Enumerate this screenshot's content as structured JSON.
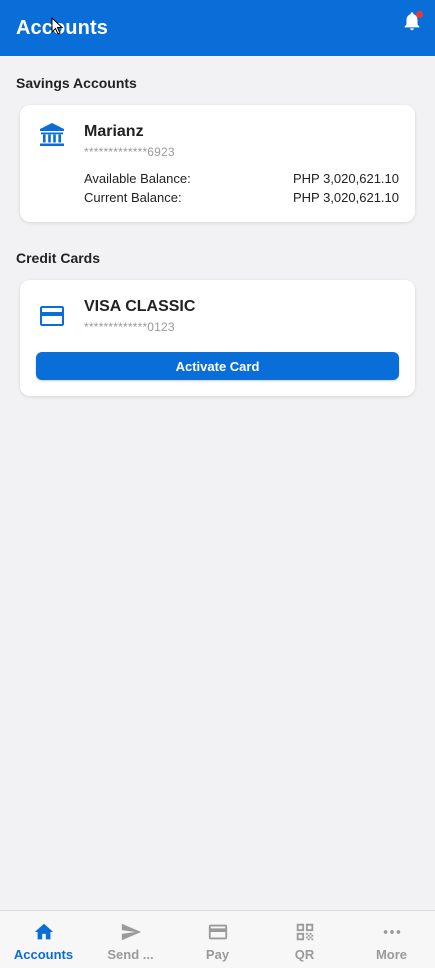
{
  "header": {
    "title": "Accounts",
    "notification_icon": "bell-icon",
    "notification_dot_color": "#e53935"
  },
  "savings": {
    "section_title": "Savings Accounts",
    "account": {
      "icon": "bank-icon",
      "name": "Marianz",
      "number": "*************6923",
      "available_label": "Available Balance:",
      "available_value": "PHP 3,020,621.10",
      "current_label": "Current Balance:",
      "current_value": "PHP 3,020,621.10"
    }
  },
  "credit": {
    "section_title": "Credit Cards",
    "card": {
      "icon": "credit-card-icon",
      "name": "VISA CLASSIC",
      "number": "*************0123",
      "button_label": "Activate Card"
    }
  },
  "nav": {
    "items": [
      {
        "label": "Accounts",
        "icon": "home-icon",
        "active": true
      },
      {
        "label": "Send ...",
        "icon": "send-icon",
        "active": false
      },
      {
        "label": "Pay",
        "icon": "card-icon",
        "active": false
      },
      {
        "label": "QR",
        "icon": "qr-icon",
        "active": false
      },
      {
        "label": "More",
        "icon": "more-icon",
        "active": false
      }
    ]
  },
  "colors": {
    "primary": "#0a6ed8",
    "background": "#f2f2f4",
    "muted": "#9a9a9a"
  }
}
